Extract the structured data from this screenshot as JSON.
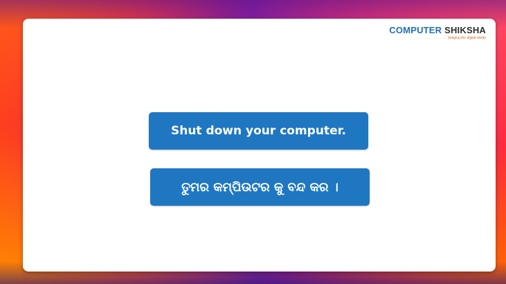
{
  "logo": {
    "brand_part1": "COMPUTER",
    "brand_part2": " SHIKSHA",
    "tagline": "bridging the digital divide"
  },
  "slide": {
    "english_text": "Shut down your computer.",
    "odia_text": "ତୁମର କମ୍ପିଉଟର କୁ ବନ୍ଦ କର ।"
  },
  "colors": {
    "button_blue": "#1f77c2",
    "logo_blue": "#1f6fb8",
    "tagline_orange": "#e06a1a"
  }
}
